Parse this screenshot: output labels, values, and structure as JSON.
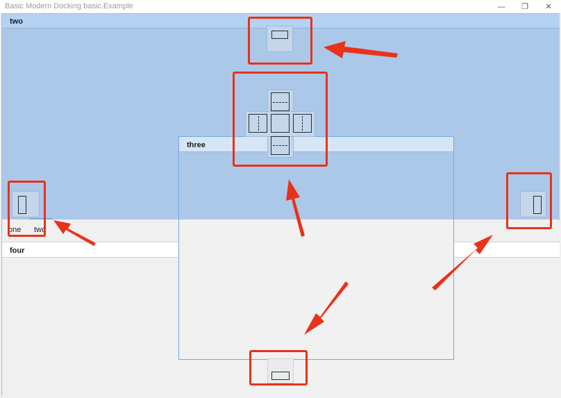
{
  "window": {
    "title": "Basic Modern Docking basic.Example",
    "minimize_glyph": "—",
    "restore_glyph": "❐",
    "close_glyph": "✕"
  },
  "panes": {
    "two_title": "two",
    "three_title": "three",
    "four_title": "four"
  },
  "tabs": [
    {
      "label": "one"
    },
    {
      "label": "two"
    }
  ],
  "colors": {
    "dock_preview": "#abc8e8",
    "annotation_red": "#e8321a",
    "floating_border": "#6fa8e6"
  },
  "icons": {
    "dock_top": "dock-top-icon",
    "dock_left": "dock-left-icon",
    "dock_right": "dock-right-icon",
    "dock_bottom": "dock-bottom-icon",
    "dock_center": "dock-center-icon",
    "arrow": "red-arrow-icon"
  }
}
